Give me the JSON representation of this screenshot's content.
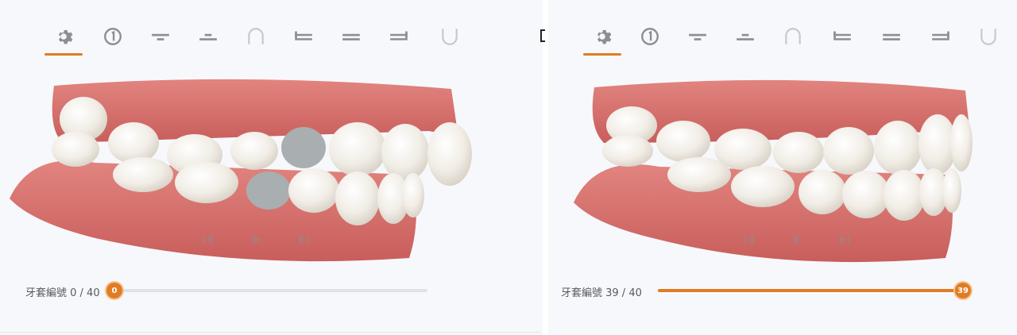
{
  "toolbar": {
    "items": [
      {
        "name": "settings",
        "icon": "gear-icon"
      },
      {
        "name": "step-1",
        "icon": "circle-one-icon"
      },
      {
        "name": "upper-view",
        "icon": "upper-line-icon"
      },
      {
        "name": "lower-view",
        "icon": "lower-line-icon"
      },
      {
        "name": "upper-arch",
        "icon": "upper-arch-icon"
      },
      {
        "name": "left-view",
        "icon": "left-lines-icon"
      },
      {
        "name": "front-view",
        "icon": "front-lines-icon"
      },
      {
        "name": "right-view",
        "icon": "right-lines-icon"
      },
      {
        "name": "lower-arch",
        "icon": "lower-arch-icon"
      }
    ],
    "active_index": 0
  },
  "left": {
    "slider_label": "牙套編號 0 / 40",
    "current": 0,
    "total": 40,
    "thumb_text": "0",
    "progress": 0.0
  },
  "right": {
    "slider_label": "牙套編號 39 / 40",
    "current": 39,
    "total": 40,
    "thumb_text": "39",
    "progress": 0.975
  },
  "colors": {
    "accent": "#e07c23",
    "icon": "#8a8f96",
    "gum": "#d9706e",
    "tooth": "#f1ede6",
    "attachment": "#a9aeb0"
  }
}
